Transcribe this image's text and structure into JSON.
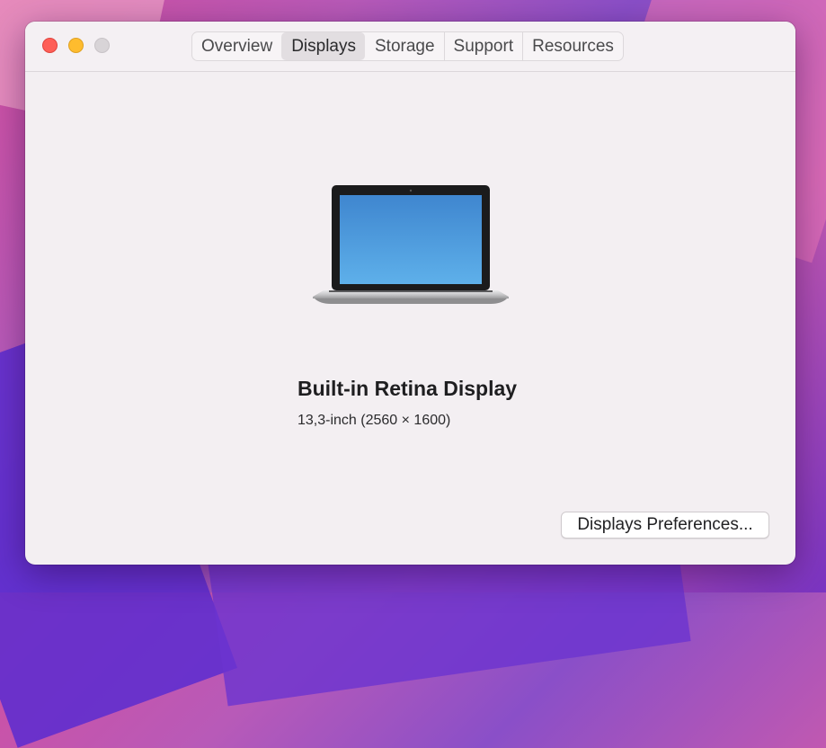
{
  "window": {
    "controls": {
      "close": "close-button",
      "minimize": "minimize-button",
      "zoom": "zoom-button"
    },
    "tabs": [
      {
        "label": "Overview",
        "selected": false
      },
      {
        "label": "Displays",
        "selected": true
      },
      {
        "label": "Storage",
        "selected": false
      },
      {
        "label": "Support",
        "selected": false
      },
      {
        "label": "Resources",
        "selected": false
      }
    ]
  },
  "display": {
    "icon": "laptop-icon",
    "name": "Built-in Retina Display",
    "spec": "13,3-inch (2560 × 1600)"
  },
  "actions": {
    "preferences_label": "Displays Preferences..."
  },
  "colors": {
    "close": "#fe5f57",
    "minimize": "#febc2e",
    "zoom_inactive": "#d8d4d7",
    "window_bg": "#f3eff2",
    "screen_blue": "#4a96d8"
  }
}
